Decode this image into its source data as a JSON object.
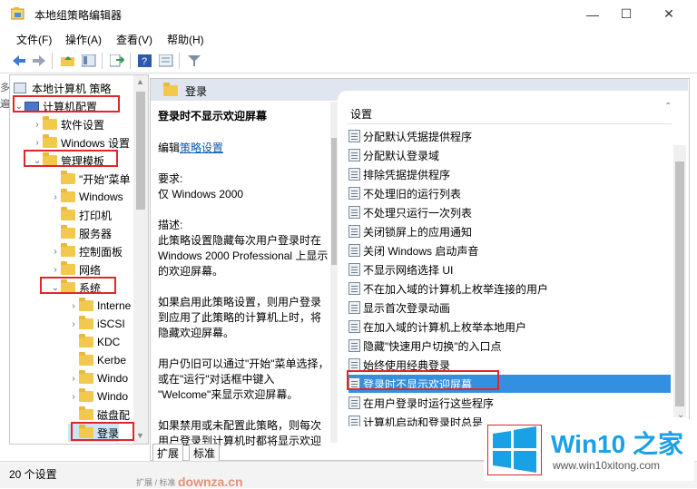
{
  "window": {
    "title": "本地组策略编辑器",
    "minimize": "—",
    "maximize": "☐",
    "close": "✕"
  },
  "menu": [
    "文件(F)",
    "操作(A)",
    "查看(V)",
    "帮助(H)"
  ],
  "tree": {
    "root": "本地计算机 策略",
    "items": [
      {
        "label": "计算机配置",
        "caret": "⌄"
      },
      {
        "label": "软件设置",
        "caret": "›"
      },
      {
        "label": "Windows 设置",
        "caret": "›"
      },
      {
        "label": "管理模板",
        "caret": "⌄"
      },
      {
        "label": "\"开始\"菜单",
        "caret": ""
      },
      {
        "label": "Windows",
        "caret": "›"
      },
      {
        "label": "打印机",
        "caret": ""
      },
      {
        "label": "服务器",
        "caret": ""
      },
      {
        "label": "控制面板",
        "caret": "›"
      },
      {
        "label": "网络",
        "caret": "›"
      },
      {
        "label": "系统",
        "caret": "⌄"
      },
      {
        "label": "Interne",
        "caret": "›"
      },
      {
        "label": "iSCSI",
        "caret": "›"
      },
      {
        "label": "KDC",
        "caret": ""
      },
      {
        "label": "Kerbe",
        "caret": ""
      },
      {
        "label": "Windo",
        "caret": "›"
      },
      {
        "label": "Windo",
        "caret": "›"
      },
      {
        "label": "磁盘配",
        "caret": ""
      },
      {
        "label": "登录",
        "caret": ""
      }
    ]
  },
  "left_edge": [
    "多",
    "遍"
  ],
  "header": {
    "folder_label": "登录"
  },
  "description": {
    "title": "登录时不显示欢迎屏幕",
    "edit_prefix": "编辑",
    "edit_link": "策略设置",
    "req_label": "要求:",
    "req_value": "仅 Windows 2000",
    "desc_label": "描述:",
    "desc_body": "此策略设置隐藏每次用户登录时在 Windows 2000 Professional 上显示的欢迎屏幕。",
    "para2": "如果启用此策略设置，则用户登录到应用了此策略的计算机上时，将隐藏欢迎屏幕。",
    "para3": "用户仍旧可以通过\"开始\"菜单选择，或在\"运行\"对话框中键入 \"Welcome\"来显示欢迎屏幕。",
    "para4_line1": "如果禁用或未配置此策略，则每次",
    "para4_line2": "用户登录到计算机时都将显示欢迎"
  },
  "list": {
    "header": "设置",
    "items": [
      "分配默认凭据提供程序",
      "分配默认登录域",
      "排除凭据提供程序",
      "不处理旧的运行列表",
      "不处理只运行一次列表",
      "关闭锁屏上的应用通知",
      "关闭 Windows 启动声音",
      "不显示网络选择 UI",
      "不在加入域的计算机上枚举连接的用户",
      "显示首次登录动画",
      "在加入域的计算机上枚举本地用户",
      "隐藏\"快速用户切换\"的入口点",
      "始终使用经典登录",
      "登录时不显示欢迎屏幕",
      "在用户登录时运行这些程序",
      "计算机启动和登录时总是"
    ],
    "selected_index": 13
  },
  "tabs": [
    "扩展",
    "标准"
  ],
  "status": "20 个设置",
  "watermark": {
    "brand": "Win10 之家",
    "url": "www.win10xitong.com",
    "bottom": "downza.cn",
    "bottom_tabs": "扩展 / 标准"
  },
  "colors": {
    "selection": "#3390e0",
    "highlight_box": "#e0262b",
    "logo_blue": "#1aa0e6"
  }
}
